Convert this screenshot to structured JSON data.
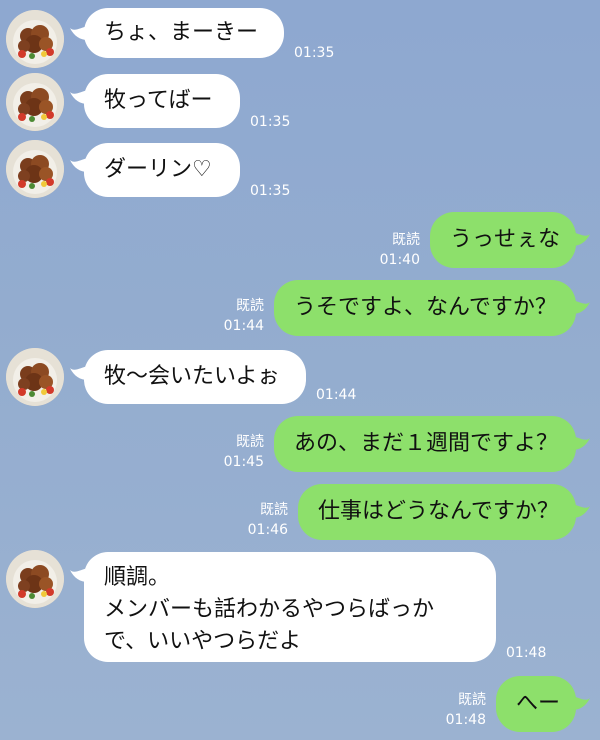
{
  "messages": [
    {
      "side": "in",
      "text": "ちょ、まーきー",
      "time": "01:35"
    },
    {
      "side": "in",
      "text": "牧ってばー",
      "time": "01:35"
    },
    {
      "side": "in",
      "text": "ダーリン♡",
      "time": "01:35"
    },
    {
      "side": "out",
      "text": "うっせぇな",
      "read": "既読",
      "time": "01:40"
    },
    {
      "side": "out",
      "text": "うそですよ、なんですか？",
      "read": "既読",
      "time": "01:44"
    },
    {
      "side": "in",
      "text": "牧〜会いたいよぉ",
      "time": "01:44"
    },
    {
      "side": "out",
      "text": "あの、まだ１週間ですよ？",
      "read": "既読",
      "time": "01:45"
    },
    {
      "side": "out",
      "text": "仕事はどうなんですか？",
      "read": "既読",
      "time": "01:46"
    },
    {
      "side": "in",
      "lines": [
        "順調。",
        "メンバーも話わかるやつらばっか",
        "で、いいやつらだよ"
      ],
      "time": "01:48"
    },
    {
      "side": "out",
      "text": "へー",
      "read": "既読",
      "time": "01:48"
    }
  ],
  "colors": {
    "background": "#94adcf",
    "incoming_bubble": "#ffffff",
    "outgoing_bubble": "#8de06b",
    "meta_text": "#ffffff"
  },
  "icons": {
    "avatar": "food-dish-avatar"
  }
}
